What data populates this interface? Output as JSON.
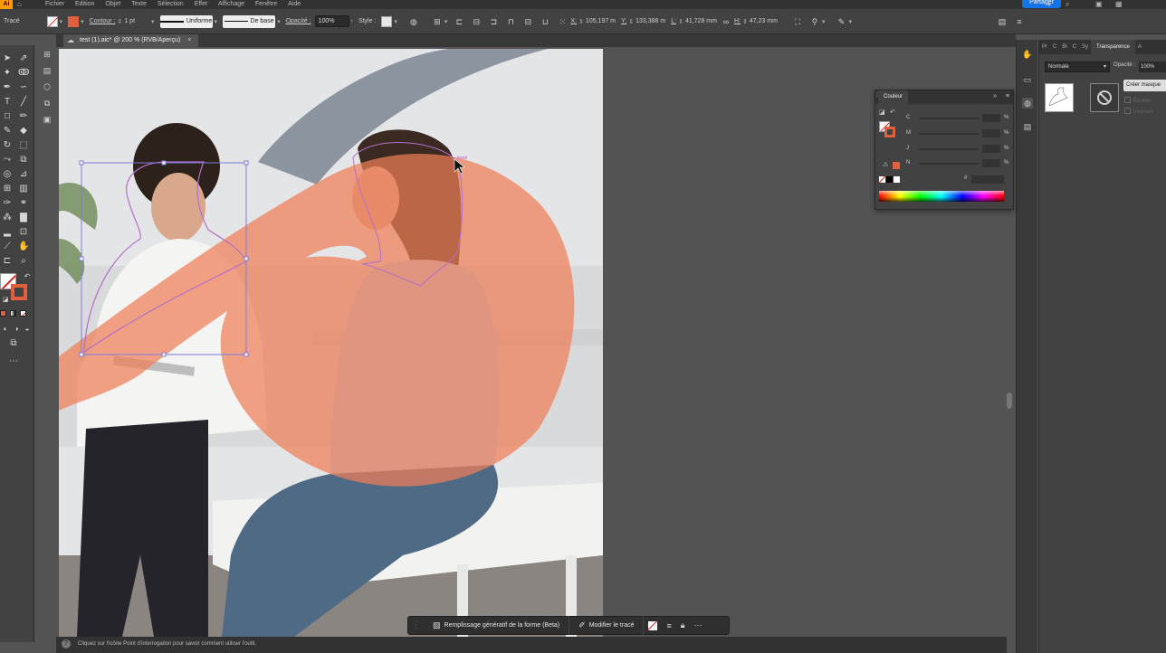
{
  "app": {
    "logo": "Ai",
    "menu": [
      "Fichier",
      "Edition",
      "Objet",
      "Texte",
      "Sélection",
      "Effet",
      "Affichage",
      "Fenêtre",
      "Aide"
    ],
    "share_label": "Partager"
  },
  "controlbar": {
    "object_type": "Tracé",
    "contour_label": "Contour :",
    "stroke_weight": "1 pt",
    "profile_uniform": "Uniforme",
    "brush_basic": "De base",
    "opacity_label": "Opacité :",
    "opacity_value": "100%",
    "style_label": "Style :",
    "x_label": "X:",
    "x_value": "105,197 m",
    "y_label": "Y:",
    "y_value": "133,388 m",
    "w_label": "L:",
    "w_value": "41,728 mm",
    "h_label": "H:",
    "h_value": "47,23 mm"
  },
  "document": {
    "tab_title": "test (1).aic* @ 200 % (RVB/Aperçu)",
    "close_glyph": "×",
    "anchor_hint": "tracé"
  },
  "status": {
    "help_glyph": "?",
    "message": "Cliquez sur l'icône Point d'interrogation pour savoir comment utiliser l'outil."
  },
  "context_bar": {
    "generative_fill": "Remplissage génératif de la forme (Beta)",
    "edit_path": "Modifier le tracé",
    "more": "⋯"
  },
  "color_panel": {
    "title": "Couleur",
    "channels": [
      {
        "label": "C",
        "unit": "%"
      },
      {
        "label": "M",
        "unit": "%"
      },
      {
        "label": "J",
        "unit": "%"
      },
      {
        "label": "N",
        "unit": "%"
      }
    ],
    "hex_label": "#",
    "fill_color": "#e0603e"
  },
  "transparency_panel": {
    "tabs": [
      "Pr",
      "C",
      "Bi",
      "C",
      "Sy",
      "Transparence",
      "A"
    ],
    "active_tab": "Transparence",
    "blend_mode": "Normale",
    "opacity_label": "Opacité :",
    "opacity_value": "100%",
    "mask_button": "Créer masque",
    "clip_label": "Écrêter",
    "invert_label": "Inverser"
  },
  "colors": {
    "accent_fill": "#e0603e",
    "selection": "#7b7bdf",
    "share_button": "#1473e6"
  }
}
